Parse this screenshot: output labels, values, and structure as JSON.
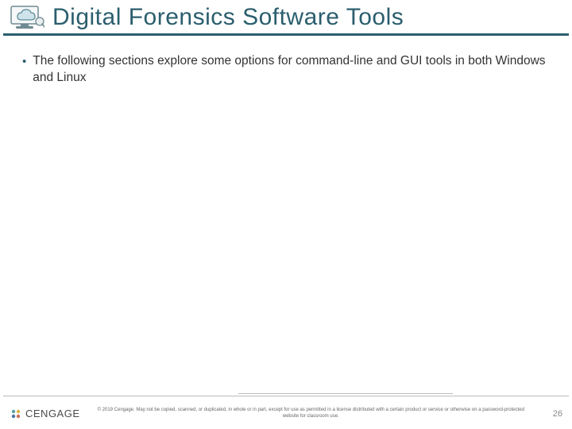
{
  "header": {
    "title": "Digital Forensics Software Tools",
    "icon_name": "cloud-monitor-icon"
  },
  "body": {
    "bullets": [
      "The following sections explore some options for command-line and GUI tools in both Windows and Linux"
    ]
  },
  "footer": {
    "brand_icon_name": "cengage-logo-icon",
    "brand_text": "CENGAGE",
    "legal": "© 2019 Cengage. May not be copied, scanned, or duplicated, in whole or in part, except for use as permitted in a license distributed with a certain product or service or otherwise on a password-protected website for classroom use.",
    "page_number": "26"
  }
}
